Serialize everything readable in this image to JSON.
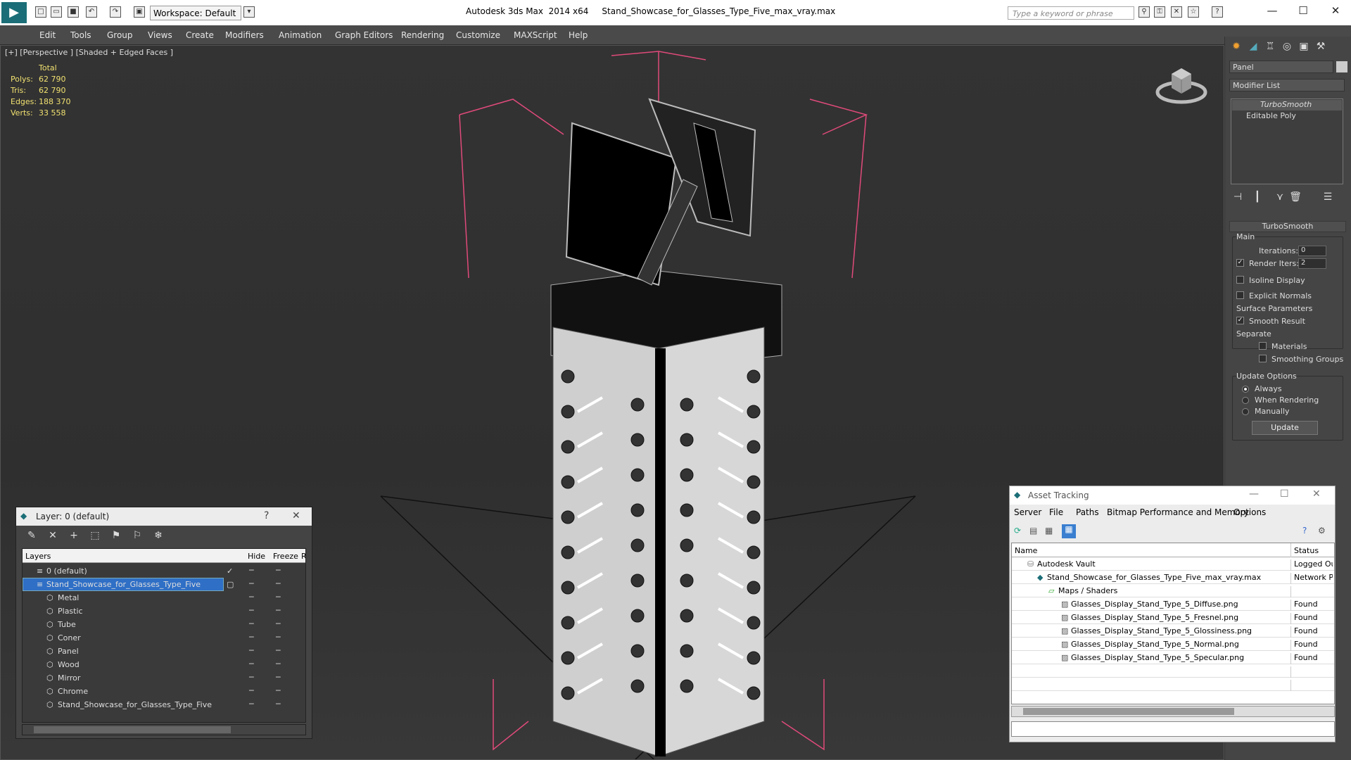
{
  "app": {
    "title": "Autodesk 3ds Max  2014 x64     Stand_Showcase_for_Glasses_Type_Five_max_vray.max",
    "workspace": "Workspace: Default",
    "search_placeholder": "Type a keyword or phrase"
  },
  "menu": [
    "Edit",
    "Tools",
    "Group",
    "Views",
    "Create",
    "Modifiers",
    "Animation",
    "Graph Editors",
    "Rendering",
    "Customize",
    "MAXScript",
    "Help"
  ],
  "viewport": {
    "label": "[+] [Perspective ] [Shaded + Edged Faces ]",
    "stats_header": "Total",
    "stats": [
      {
        "label": "Polys:",
        "value": "62 790"
      },
      {
        "label": "Tris:",
        "value": "62 790"
      },
      {
        "label": "Edges:",
        "value": "188 370"
      },
      {
        "label": "Verts:",
        "value": "33 558"
      }
    ]
  },
  "command_panel": {
    "object_name": "Panel",
    "modifier_list": "Modifier List",
    "stack": [
      "TurboSmooth",
      "Editable Poly"
    ],
    "rollout_title": "TurboSmooth",
    "main_label": "Main",
    "iterations_label": "Iterations:",
    "iterations_value": "0",
    "render_iters_label": "Render Iters:",
    "render_iters_value": "2",
    "isoline": "Isoline Display",
    "explicit_normals": "Explicit Normals",
    "surface_params": "Surface Parameters",
    "smooth_result": "Smooth Result",
    "separate": "Separate",
    "materials": "Materials",
    "smoothing_groups": "Smoothing Groups",
    "update_options": "Update Options",
    "always": "Always",
    "when_rendering": "When Rendering",
    "manually": "Manually",
    "update_button": "Update"
  },
  "layer_window": {
    "title": "Layer: 0 (default)",
    "help": "?",
    "col_layers": "Layers",
    "col_hide": "Hide",
    "col_freeze": "Freeze",
    "col_r": "R",
    "default_layer": "0 (default)",
    "selected_layer": "Stand_Showcase_for_Glasses_Type_Five",
    "objects": [
      "Metal",
      "Plastic",
      "Tube",
      "Coner",
      "Panel",
      "Wood",
      "Mirror",
      "Chrome",
      "Stand_Showcase_for_Glasses_Type_Five"
    ]
  },
  "asset_window": {
    "title": "Asset Tracking",
    "menu": [
      "Server",
      "File",
      "Paths",
      "Bitmap Performance and Memory",
      "Options"
    ],
    "col_name": "Name",
    "col_status": "Status",
    "rows": [
      {
        "name": "Autodesk Vault",
        "status": "Logged Ou"
      },
      {
        "name": "Stand_Showcase_for_Glasses_Type_Five_max_vray.max",
        "status": "Network Pa"
      },
      {
        "name": "Maps / Shaders",
        "status": ""
      },
      {
        "name": "Glasses_Display_Stand_Type_5_Diffuse.png",
        "status": "Found"
      },
      {
        "name": "Glasses_Display_Stand_Type_5_Fresnel.png",
        "status": "Found"
      },
      {
        "name": "Glasses_Display_Stand_Type_5_Glossiness.png",
        "status": "Found"
      },
      {
        "name": "Glasses_Display_Stand_Type_5_Normal.png",
        "status": "Found"
      },
      {
        "name": "Glasses_Display_Stand_Type_5_Specular.png",
        "status": "Found"
      }
    ]
  }
}
